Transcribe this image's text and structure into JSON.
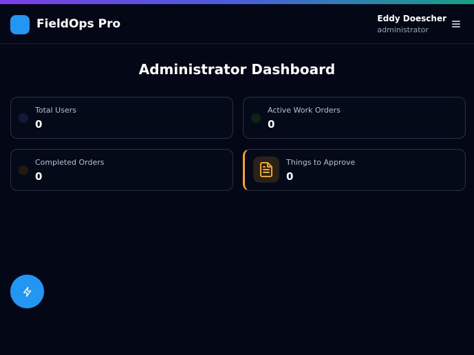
{
  "header": {
    "app_title": "FieldOps Pro",
    "user_name": "Eddy Doescher",
    "user_role": "administrator",
    "logo_color": "#2196f3",
    "menu_icon": "hamburger-menu-icon"
  },
  "page": {
    "title": "Administrator Dashboard"
  },
  "stats": [
    {
      "label": "Total Users",
      "value": "0",
      "dot_color": "#101a3a"
    },
    {
      "label": "Active Work Orders",
      "value": "0",
      "dot_color": "#0b2418"
    },
    {
      "label": "Completed Orders",
      "value": "0",
      "dot_color": "#24190f"
    },
    {
      "label": "Things to Approve",
      "value": "0",
      "accent_color": "#f5a623",
      "icon": "document-icon"
    }
  ],
  "fab": {
    "icon": "lightning-bolt-icon",
    "color": "#2196f3"
  }
}
